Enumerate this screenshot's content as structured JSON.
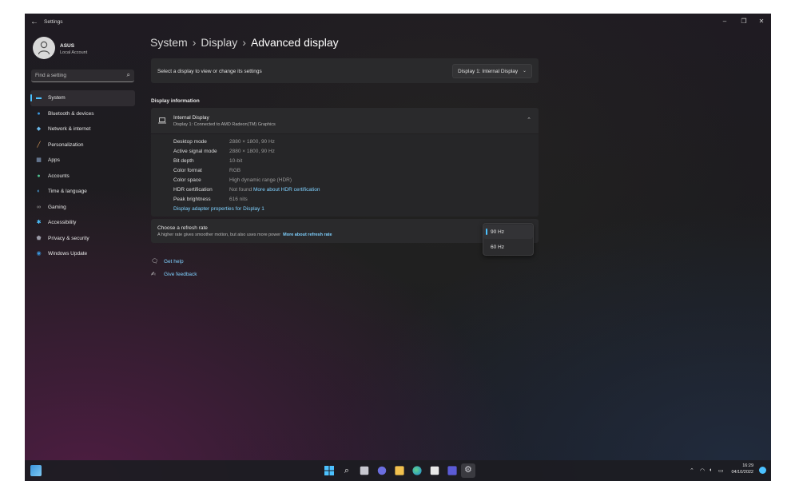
{
  "window": {
    "app_title": "Settings",
    "back_icon": "back-arrow-icon",
    "controls": [
      "minimize-icon",
      "restore-icon",
      "close-icon"
    ]
  },
  "user": {
    "name": "ASUS",
    "account_type": "Local Account"
  },
  "search": {
    "placeholder": "Find a setting"
  },
  "sidebar": {
    "items": [
      {
        "label": "System",
        "icon": "display-icon",
        "active": true,
        "color": "#4cc2ff"
      },
      {
        "label": "Bluetooth & devices",
        "icon": "bluetooth-icon",
        "color": "#3a96dd"
      },
      {
        "label": "Network & internet",
        "icon": "wifi-icon",
        "color": "#6bb7e8"
      },
      {
        "label": "Personalization",
        "icon": "brush-icon",
        "color": "#e8a35c"
      },
      {
        "label": "Apps",
        "icon": "apps-icon",
        "color": "#8aa4c8"
      },
      {
        "label": "Accounts",
        "icon": "person-icon",
        "color": "#4fbf8f"
      },
      {
        "label": "Time & language",
        "icon": "globe-clock-icon",
        "color": "#4ca8e8"
      },
      {
        "label": "Gaming",
        "icon": "controller-icon",
        "color": "#a0a0a0"
      },
      {
        "label": "Accessibility",
        "icon": "accessibility-icon",
        "color": "#4cc2ff"
      },
      {
        "label": "Privacy & security",
        "icon": "shield-icon",
        "color": "#9a9aa6"
      },
      {
        "label": "Windows Update",
        "icon": "update-icon",
        "color": "#3a96dd"
      }
    ]
  },
  "breadcrumb": {
    "parts": [
      "System",
      "Display",
      "Advanced display"
    ],
    "separator": "›"
  },
  "display_select": {
    "label": "Select a display to view or change its settings",
    "value": "Display 1: Internal Display"
  },
  "display_info": {
    "section_title": "Display information",
    "name": "Internal Display",
    "subtitle": "Display 1: Connected to AMD Radeon(TM) Graphics",
    "rows": [
      {
        "key": "Desktop mode",
        "value": "2880 × 1800, 90 Hz"
      },
      {
        "key": "Active signal mode",
        "value": "2880 × 1800, 90 Hz"
      },
      {
        "key": "Bit depth",
        "value": "10-bit"
      },
      {
        "key": "Color format",
        "value": "RGB"
      },
      {
        "key": "Color space",
        "value": "High dynamic range (HDR)"
      },
      {
        "key": "HDR certification",
        "value": "Not found",
        "link": "More about HDR certification"
      },
      {
        "key": "Peak brightness",
        "value": "616 nits"
      }
    ],
    "adapter_link": "Display adapter properties for Display 1"
  },
  "refresh": {
    "title": "Choose a refresh rate",
    "description": "A higher rate gives smoother motion, but also uses more power",
    "link": "More about refresh rate",
    "options": [
      "90 Hz",
      "60 Hz"
    ],
    "selected": "90 Hz"
  },
  "help": {
    "get_help": "Get help",
    "give_feedback": "Give feedback"
  },
  "taskbar": {
    "time": "16:29",
    "date": "04/10/2022",
    "icons": [
      "widgets-icon",
      "windows-start-icon",
      "search-icon",
      "task-view-icon",
      "chat-icon",
      "file-explorer-icon",
      "edge-icon",
      "store-icon",
      "app-icon",
      "settings-gear-icon"
    ],
    "tray_icons": [
      "chevron-up-icon",
      "wifi-icon",
      "volume-icon",
      "battery-icon"
    ]
  },
  "colors": {
    "accent": "#4cc2ff",
    "card": "#2a2a2c"
  }
}
